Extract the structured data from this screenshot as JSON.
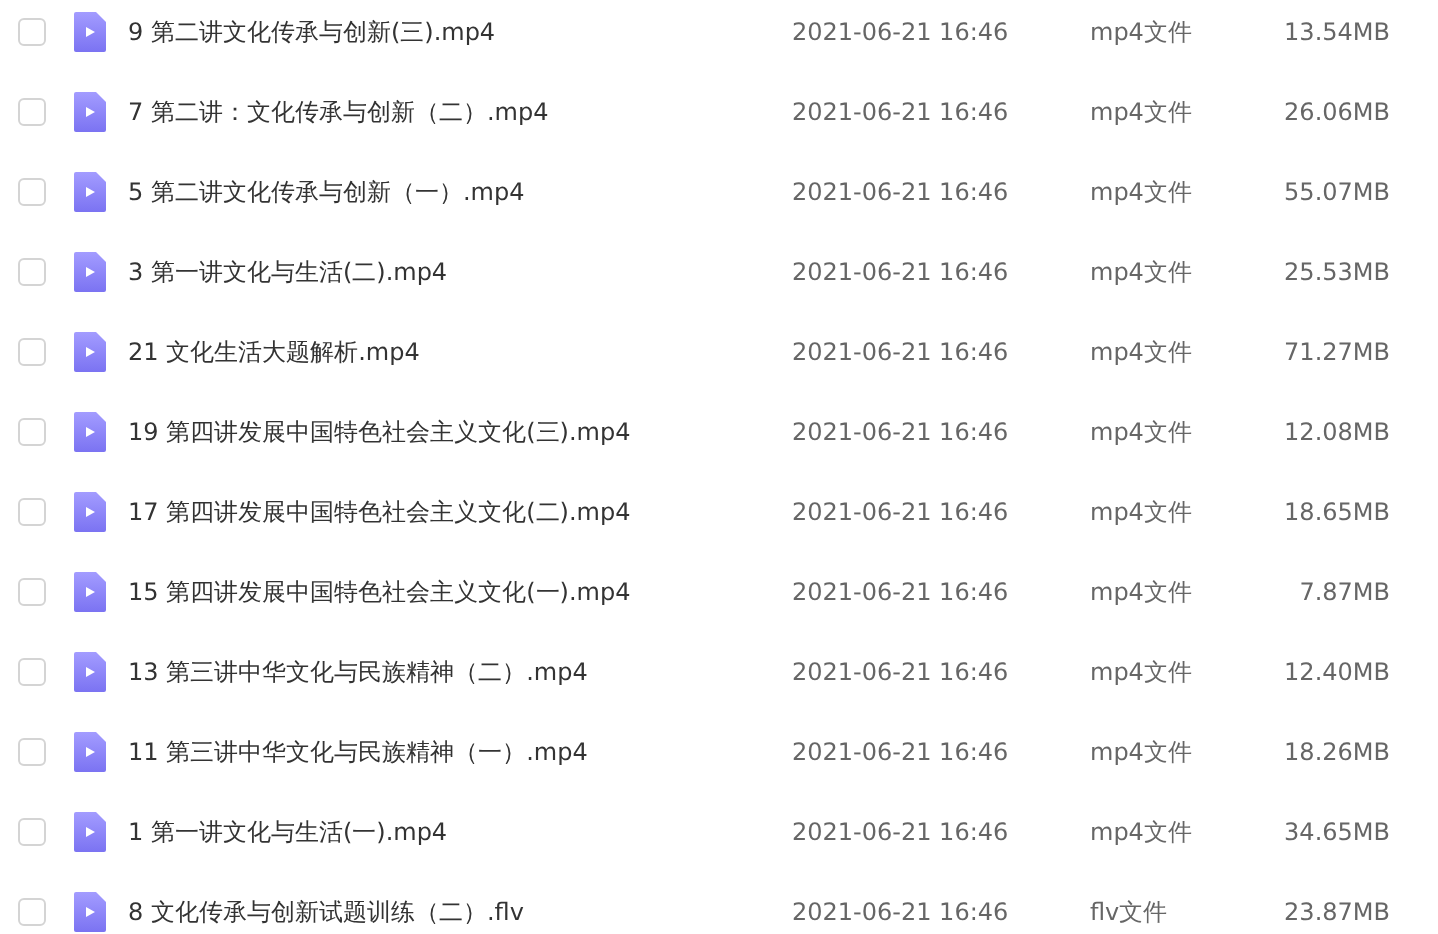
{
  "files": [
    {
      "checked": false,
      "name": "9 第二讲文化传承与创新(三).mp4",
      "date": "2021-06-21 16:46",
      "type": "mp4文件",
      "size": "13.54MB"
    },
    {
      "checked": false,
      "name": "7 第二讲：文化传承与创新（二）.mp4",
      "date": "2021-06-21 16:46",
      "type": "mp4文件",
      "size": "26.06MB"
    },
    {
      "checked": false,
      "name": "5 第二讲文化传承与创新（一）.mp4",
      "date": "2021-06-21 16:46",
      "type": "mp4文件",
      "size": "55.07MB"
    },
    {
      "checked": false,
      "name": "3 第一讲文化与生活(二).mp4",
      "date": "2021-06-21 16:46",
      "type": "mp4文件",
      "size": "25.53MB"
    },
    {
      "checked": false,
      "name": "21 文化生活大题解析.mp4",
      "date": "2021-06-21 16:46",
      "type": "mp4文件",
      "size": "71.27MB"
    },
    {
      "checked": false,
      "name": "19 第四讲发展中国特色社会主义文化(三).mp4",
      "date": "2021-06-21 16:46",
      "type": "mp4文件",
      "size": "12.08MB"
    },
    {
      "checked": false,
      "name": "17 第四讲发展中国特色社会主义文化(二).mp4",
      "date": "2021-06-21 16:46",
      "type": "mp4文件",
      "size": "18.65MB"
    },
    {
      "checked": false,
      "name": "15 第四讲发展中国特色社会主义文化(一).mp4",
      "date": "2021-06-21 16:46",
      "type": "mp4文件",
      "size": "7.87MB"
    },
    {
      "checked": false,
      "name": "13 第三讲中华文化与民族精神（二）.mp4",
      "date": "2021-06-21 16:46",
      "type": "mp4文件",
      "size": "12.40MB"
    },
    {
      "checked": false,
      "name": "11 第三讲中华文化与民族精神（一）.mp4",
      "date": "2021-06-21 16:46",
      "type": "mp4文件",
      "size": "18.26MB"
    },
    {
      "checked": false,
      "name": "1 第一讲文化与生活(一).mp4",
      "date": "2021-06-21 16:46",
      "type": "mp4文件",
      "size": "34.65MB"
    },
    {
      "checked": false,
      "name": "8 文化传承与创新试题训练（二）.flv",
      "date": "2021-06-21 16:46",
      "type": "flv文件",
      "size": "23.87MB"
    }
  ]
}
